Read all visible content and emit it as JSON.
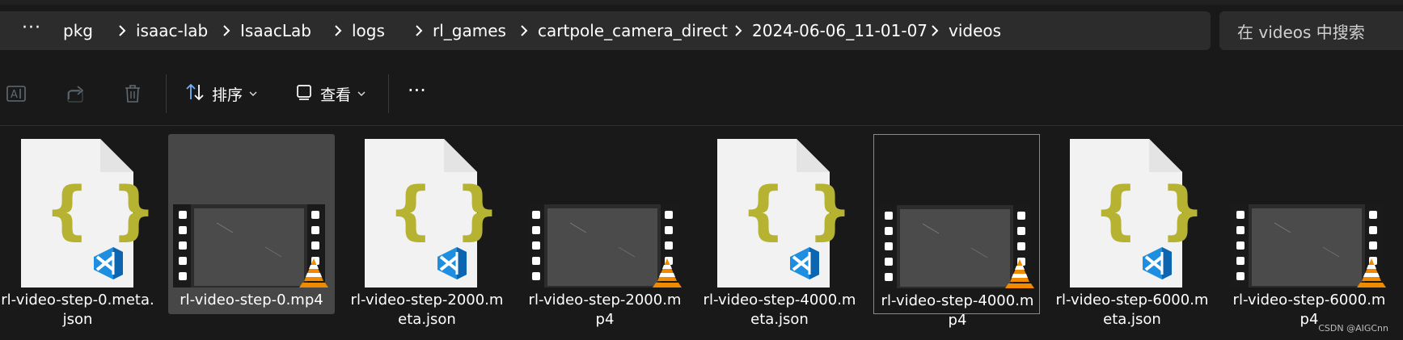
{
  "address_bar": {
    "more": "···",
    "crumbs": [
      "pkg",
      "isaac-lab",
      "IsaacLab",
      "logs",
      "rl_games",
      "cartpole_camera_direct",
      "2024-06-06_11-01-07",
      "videos"
    ]
  },
  "search": {
    "placeholder": "在 videos 中搜索"
  },
  "toolbar": {
    "sort_label": "排序",
    "view_label": "查看",
    "more_label": "···",
    "icons": [
      "rename-icon",
      "share-icon",
      "delete-icon",
      "sort-icon",
      "view-icon",
      "more-icon"
    ]
  },
  "files": [
    {
      "name": "rl-video-step-0.meta.json",
      "kind": "json"
    },
    {
      "name": "rl-video-step-0.mp4",
      "kind": "mp4"
    },
    {
      "name": "rl-video-step-2000.meta.json",
      "kind": "json"
    },
    {
      "name": "rl-video-step-2000.mp4",
      "kind": "mp4"
    },
    {
      "name": "rl-video-step-4000.meta.json",
      "kind": "json"
    },
    {
      "name": "rl-video-step-4000.mp4",
      "kind": "mp4"
    },
    {
      "name": "rl-video-step-6000.meta.json",
      "kind": "json"
    },
    {
      "name": "rl-video-step-6000.mp4",
      "kind": "mp4"
    }
  ],
  "labels": {
    "f0": "rl-video-step-0.meta.\njson",
    "f1": "rl-video-step-0.mp4",
    "f2": "rl-video-step-2000.m\neta.json",
    "f3": "rl-video-step-2000.m\np4",
    "f4": "rl-video-step-4000.m\neta.json",
    "f5": "rl-video-step-4000.m\np4",
    "f6": "rl-video-step-6000.m\neta.json",
    "f7": "rl-video-step-6000.m\np4"
  },
  "watermark": "CSDN @AIGCnn",
  "colors": {
    "json_brace": "#b7b332",
    "vscode_blue": "#1e8ee0",
    "vlc_orange": "#f08a00",
    "selection": "#474747"
  }
}
